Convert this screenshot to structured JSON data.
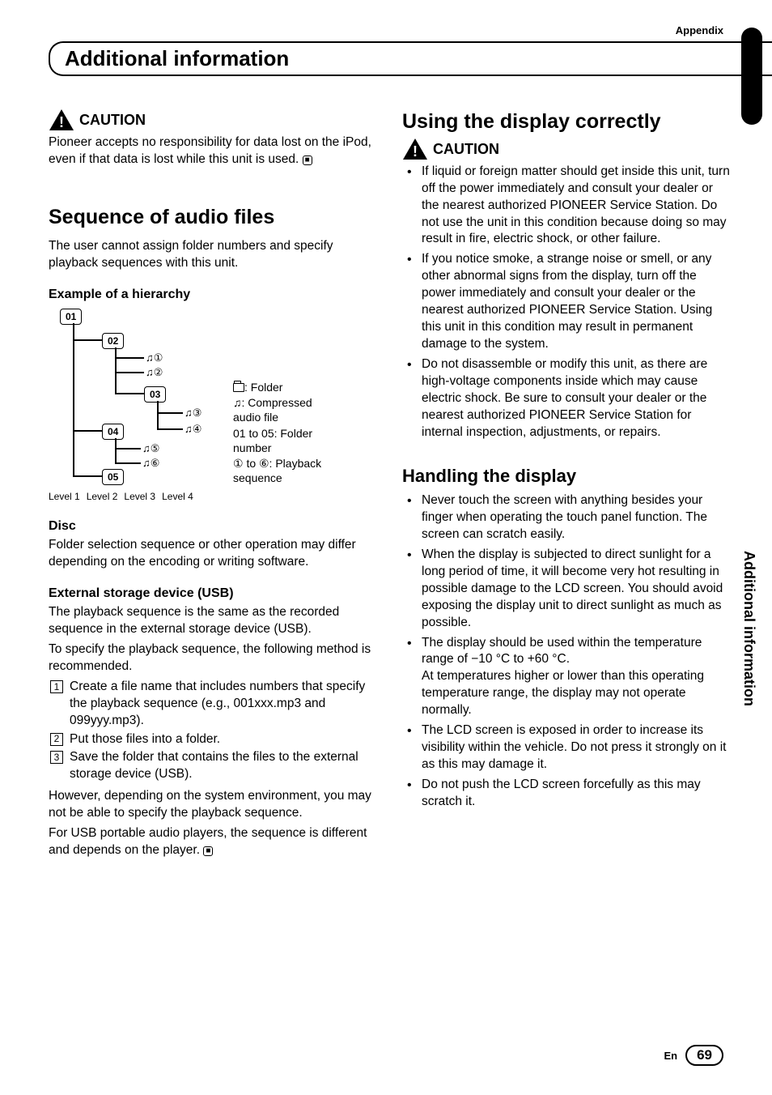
{
  "header": {
    "appendix": "Appendix",
    "title": "Additional information"
  },
  "left": {
    "caution_label": "CAUTION",
    "caution_text": "Pioneer accepts no responsibility for data lost on the iPod, even if that data is lost while this unit is used.",
    "seq_heading": "Sequence of audio files",
    "seq_intro": "The user cannot assign folder numbers and specify playback sequences with this unit.",
    "hierarchy_heading": "Example of a hierarchy",
    "hierarchy": {
      "boxes": [
        "01",
        "02",
        "03",
        "04",
        "05"
      ],
      "circled": [
        "①",
        "②",
        "③",
        "④",
        "⑤",
        "⑥"
      ],
      "levels": [
        "Level 1",
        "Level 2",
        "Level 3",
        "Level 4"
      ]
    },
    "legend": {
      "folder": ": Folder",
      "audio": ": Compressed audio file",
      "folders": "01 to 05: Folder number",
      "playback": "① to ⑥: Playback sequence"
    },
    "disc_heading": "Disc",
    "disc_text": "Folder selection sequence or other operation may differ depending on the encoding or writing software.",
    "usb_heading": "External storage device (USB)",
    "usb_text1": "The playback sequence is the same as the recorded sequence in the external storage device (USB).",
    "usb_text2": "To specify the playback sequence, the following method is recommended.",
    "steps": [
      "Create a file name that includes numbers that specify the playback sequence (e.g., 001xxx.mp3 and 099yyy.mp3).",
      "Put those files into a folder.",
      "Save the folder that contains the files to the external storage device (USB)."
    ],
    "usb_text3": "However, depending on the system environment, you may not be able to specify the playback sequence.",
    "usb_text4": "For USB portable audio players, the sequence is different and depends on the player."
  },
  "right": {
    "display_heading": "Using the display correctly",
    "caution_label": "CAUTION",
    "caution_items": [
      "If liquid or foreign matter should get inside this unit, turn off the power immediately and consult your dealer or the nearest authorized PIONEER Service Station. Do not use the unit in this condition because doing so may result in fire, electric shock, or other failure.",
      "If you notice smoke, a strange noise or smell, or any other abnormal signs from the display, turn off the power immediately and consult your dealer or the nearest authorized PIONEER Service Station. Using this unit in this condition may result in permanent damage to the system.",
      "Do not disassemble or modify this unit, as there are high-voltage components inside which may cause electric shock. Be sure to consult your dealer or the nearest authorized PIONEER Service Station for internal inspection, adjustments, or repairs."
    ],
    "handling_heading": "Handling the display",
    "handling_items": [
      "Never touch the screen with anything besides your finger when operating the touch panel function. The screen can scratch easily.",
      "When the display is subjected to direct sunlight for a long period of time, it will become very hot resulting in possible damage to the LCD screen. You should avoid exposing the display unit to direct sunlight as much as possible.",
      "The display should be used within the temperature range of −10 °C to +60 °C.\nAt temperatures higher or lower than this operating temperature range, the display may not operate normally.",
      "The LCD screen is exposed in order to increase its visibility within the vehicle. Do not press it strongly on it as this may damage it.",
      "Do not push the LCD screen forcefully as this may scratch it."
    ]
  },
  "side_label": "Additional information",
  "footer": {
    "lang": "En",
    "page": "69"
  }
}
